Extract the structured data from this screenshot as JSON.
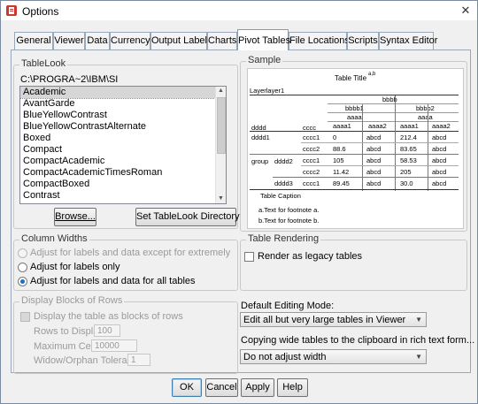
{
  "window": {
    "title": "Options",
    "close_glyph": "✕"
  },
  "tabs": [
    {
      "label": "General"
    },
    {
      "label": "Viewer"
    },
    {
      "label": "Data"
    },
    {
      "label": "Currency"
    },
    {
      "label": "Output Labels"
    },
    {
      "label": "Charts"
    },
    {
      "label": "Pivot Tables",
      "active": true
    },
    {
      "label": "File Locations"
    },
    {
      "label": "Scripts"
    },
    {
      "label": "Syntax Editor"
    }
  ],
  "tablelook": {
    "title": "TableLook",
    "path": "C:\\PROGRA~2\\IBM\\SI",
    "items": [
      "Academic",
      "AvantGarde",
      "BlueYellowContrast",
      "BlueYellowContrastAlternate",
      "Boxed",
      "Compact",
      "CompactAcademic",
      "CompactAcademicTimesRoman",
      "CompactBoxed",
      "Contrast"
    ],
    "selected": "Academic",
    "browse_label": "Browse...",
    "set_dir_label": "Set TableLook Directory"
  },
  "sample": {
    "title": "Sample",
    "table_title": "Table Title",
    "title_marker": "a,b",
    "layer": "Layerlayer1",
    "bbbb": "bbbb",
    "bbbb1": "bbbb1",
    "bbbb2": "bbbb2",
    "aaaa": "aaaa",
    "dddd": "dddd",
    "cccc": "cccc",
    "aaaa1": "aaaa1",
    "aaaa2": "aaaa2",
    "dddd1": "dddd1",
    "group": "group",
    "dddd2": "dddd2",
    "dddd3": "dddd3",
    "cccc1": "cccc1",
    "cccc2": "cccc2",
    "abcd": "abcd",
    "vals": {
      "r1a": "0",
      "r1c": "212.4",
      "r2a": "88.6",
      "r2c": "83.65",
      "r3a": "105",
      "r3c": "58.53",
      "r4a": "11.42",
      "r4c": "205",
      "r5a": "89.45",
      "r5c": "30.0"
    },
    "caption": "Table Caption",
    "footnote_a": "a.Text for footnote a.",
    "footnote_b": "b.Text for footnote b."
  },
  "column_widths": {
    "title": "Column Widths",
    "options": [
      {
        "label": "Adjust for labels and data except for extremely large tables",
        "disabled": true
      },
      {
        "label": "Adjust for labels only"
      },
      {
        "label": "Adjust for labels and data for all tables",
        "checked": true
      }
    ]
  },
  "table_rendering": {
    "title": "Table Rendering",
    "legacy_label": "Render as legacy tables"
  },
  "display_blocks": {
    "title": "Display Blocks of Rows",
    "checkbox_label": "Display the table as blocks of rows",
    "rows_label": "Rows to Display:",
    "rows_value": "100",
    "max_cells_label": "Maximum Cells:",
    "max_cells_value": "10000",
    "widow_label": "Widow/Orphan Tolerance:",
    "widow_value": "1"
  },
  "editing": {
    "mode_label": "Default Editing Mode:",
    "mode_value": "Edit all but very large tables in Viewer",
    "copy_label": "Copying wide tables to the clipboard in rich text form...",
    "copy_value": "Do not adjust width"
  },
  "footer": {
    "ok": "OK",
    "cancel": "Cancel",
    "apply": "Apply",
    "help": "Help"
  }
}
